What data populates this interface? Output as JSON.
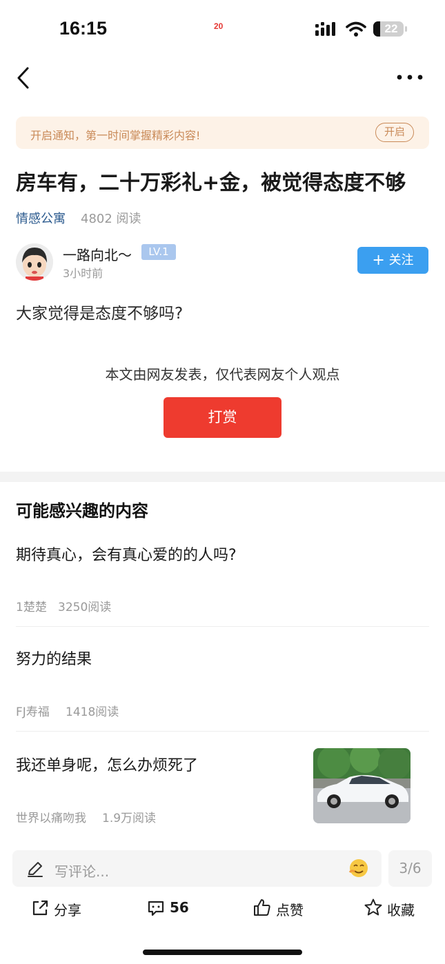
{
  "status_bar": {
    "time": "16:15",
    "center_text": "20",
    "battery": "22"
  },
  "notice": {
    "text": "开启通知，第一时间掌握精彩内容!",
    "button": "开启"
  },
  "article": {
    "title": "房车有，二十万彩礼+金，被觉得态度不够",
    "channel": "情感公寓",
    "reads": "4802 阅读",
    "author": {
      "name": "一路向北～",
      "level": "LV.1",
      "time": "3小时前"
    },
    "follow_label": "关注",
    "body": "大家觉得是态度不够吗?",
    "disclaimer": "本文由网友发表，仅代表网友个人观点",
    "reward_label": "打赏"
  },
  "recommendations": {
    "section_title": "可能感兴趣的内容",
    "items": [
      {
        "title": "期待真心，会有真心爱的的人吗?",
        "author": "1楚楚",
        "reads": "3250阅读"
      },
      {
        "title": "努力的结果",
        "author": "FJ寿福",
        "reads": "1418阅读"
      },
      {
        "title": "我还单身呢，怎么办烦死了",
        "author": "世界以痛吻我",
        "reads": "1.9万阅读"
      }
    ]
  },
  "comment_bar": {
    "placeholder": "写评论...",
    "pager": "3/6"
  },
  "actions": {
    "share": "分享",
    "comments": "56",
    "like": "点赞",
    "favorite": "收藏"
  },
  "colors": {
    "accent_blue": "#3b9ff0",
    "reward_red": "#ee3b2f",
    "notice_bg": "#fdf2e7",
    "notice_text": "#c98a58",
    "channel_blue": "#2b5a8e"
  }
}
